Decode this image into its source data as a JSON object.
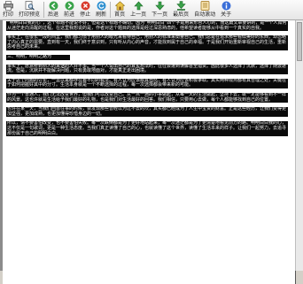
{
  "toolbar": {
    "buttons": [
      {
        "label": "打印",
        "icon": "printer-icon"
      },
      {
        "label": "打印预览",
        "icon": "print-preview-icon"
      },
      {
        "label": "后退",
        "icon": "back-icon"
      },
      {
        "label": "前进",
        "icon": "forward-icon"
      },
      {
        "label": "停止",
        "icon": "stop-icon"
      },
      {
        "label": "刷新",
        "icon": "refresh-icon"
      },
      {
        "label": "首页",
        "icon": "home-icon"
      },
      {
        "label": "上一页",
        "icon": "previous-page-icon"
      },
      {
        "label": "下一页",
        "icon": "next-page-icon"
      },
      {
        "label": "最后页",
        "icon": "last-page-icon"
      },
      {
        "label": "自动滚动",
        "icon": "auto-scroll-icon"
      },
      {
        "label": "关于",
        "icon": "about-icon"
      }
    ]
  },
  "document": {
    "paragraphs": [
      "“明明白白我的心”，这个标题不能说不好，但是这个标题不确切。因为“明明白白”四个字是用来形容人心的，而这篇文章要讲的，是一个人如何从迷茫走向清醒的过程。在这里我想说的是，作者对这个题目的选择是经过深思熟虑的，他希望读者能够从中看到一个真实的自我。",
      "事实上，在很长一段时间里，我们都习惯于用别人的眼光来看待自己，用别人的标准来衡量自己。我们总是在追求那些看似美好的东西，却忽略了内心真正的需要。直到有一天，我们终于意识到，只有听从内心的声音，才能找到属于自己的幸福。于是我们开始重新审视自己的生活，重新思考自己的未来。",
      "三、明明，明明之路为",
      "事实上，愿意听到别人的真话的人并不多。当一个人说出自己的真实想法时，往往会遭到误解甚至指责。因此很多人选择了沉默，选择了随波逐流。但是，沉默并不能解决问题，只有勇敢地面对，才能真正走出困境。",
      "关于这个问题的讨论，一直以来都存在着不同的看法。有人认为应该顺其自然，有人认为应该积极争取。其实两种观点都有其合理之处，关键在于如何把握好其中的分寸。生活本身就是一个不断选择的过程，每一次选择都会带来新的可能。",
      "作为一个普通人，我们无法改变世界，但我们可以改变自己。从一点一滴的小事做起，从每一天的生活做起，坚持下去，就一定能够看到不一样的风景。这也许就是生活给予我们最好的礼物，也是我们对生活最好的回答。我们相信，只要用心去做，每个人都能够找到自己的位置。",
      "也许在某一天，当我们回首往事的时候，会发现那些曾经以为过不去的坎，其实都已经成为了人生中宝贵的财富。正是这些经历，让我们变得更加坚强，更加成熟，也更加懂得珍惜身边的一切。",
      "所以，请不要害怕改变，也不要害怕失败。每一次跌倒都是为了更好地站起来，每一次迷茫都是为了更清楚地看见前方的路。明明白白我的心，这不仅是一句歌词，更是一种生活态度。当我们真正读懂了自己的心，也就读懂了这个世界，读懂了生活本来的样子。让我们一起努力，去追寻那份属于自己的明明白白。"
    ]
  }
}
